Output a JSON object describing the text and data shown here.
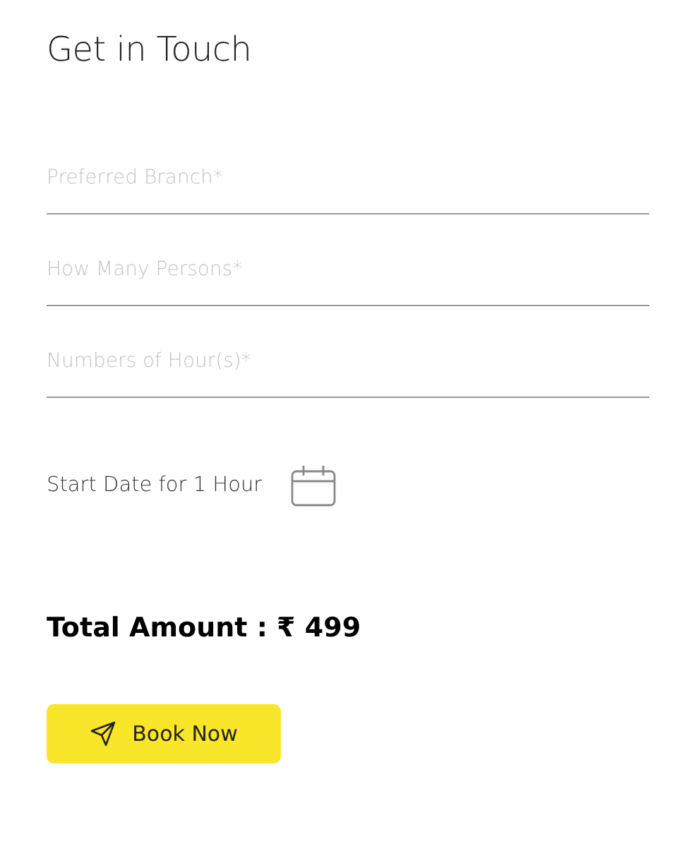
{
  "title": "Get in Touch",
  "fields": [
    {
      "placeholder": "Preferred Branch*"
    },
    {
      "placeholder": "How Many Persons*"
    },
    {
      "placeholder": "Numbers of Hour(s)*"
    }
  ],
  "date_label": "Start Date for 1 Hour",
  "total": "Total Amount : ₹ 499",
  "button": "Book Now"
}
